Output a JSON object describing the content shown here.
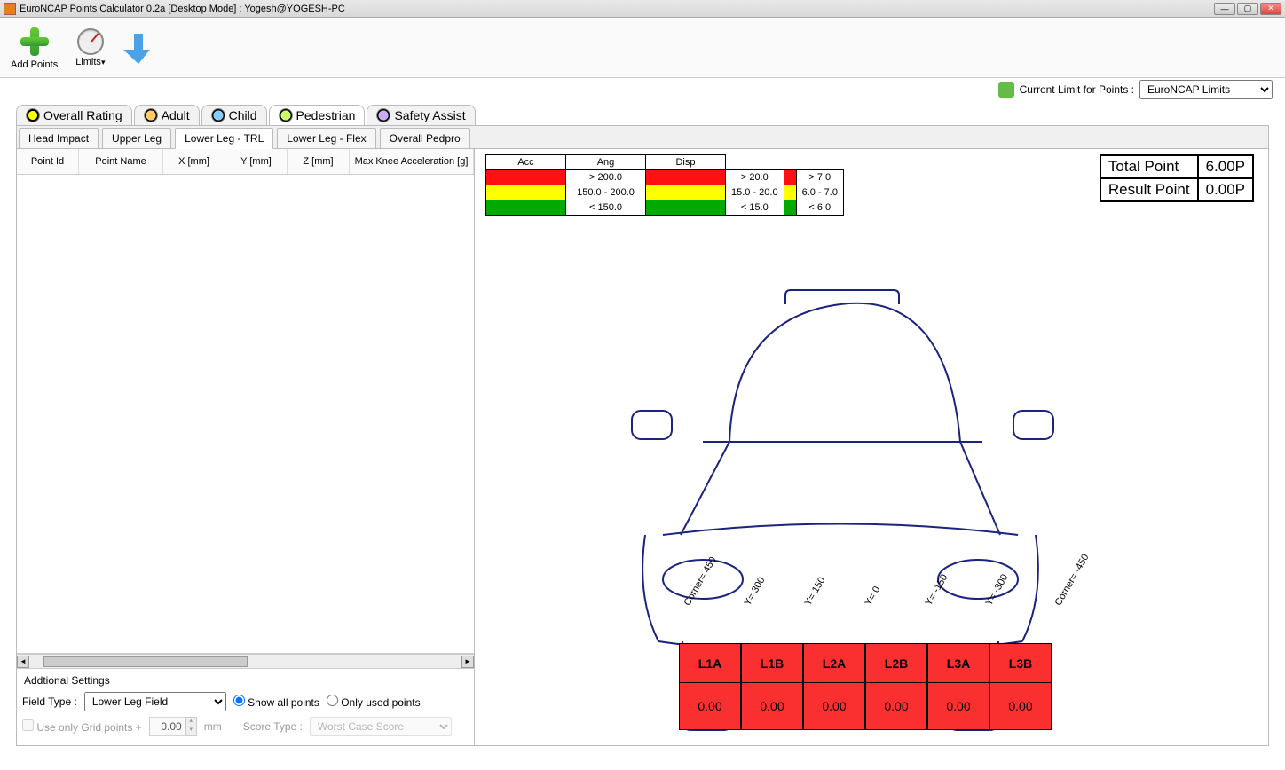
{
  "window": {
    "title": "EuroNCAP Points Calculator 0.2a [Desktop Mode] : Yogesh@YOGESH-PC"
  },
  "toolbar": {
    "add_points": "Add Points",
    "limits": "Limits"
  },
  "limits_bar": {
    "label": "Current Limit for Points :",
    "selected": "EuroNCAP Limits"
  },
  "tabs": [
    "Overall Rating",
    "Adult",
    "Child",
    "Pedestrian",
    "Safety Assist"
  ],
  "active_tab_index": 3,
  "subtabs": [
    "Head Impact",
    "Upper Leg",
    "Lower Leg - TRL",
    "Lower Leg - Flex",
    "Overall Pedpro"
  ],
  "active_subtab_index": 2,
  "grid_headers": [
    "Point Id",
    "Point Name",
    "X [mm]",
    "Y [mm]",
    "Z [mm]",
    "Max Knee Acceleration [g]"
  ],
  "legend": {
    "cols": [
      "Acc",
      "Ang",
      "Disp"
    ],
    "rows": [
      {
        "color": "red",
        "vals": [
          "> 200.0",
          "> 20.0",
          "> 7.0"
        ]
      },
      {
        "color": "yel",
        "vals": [
          "150.0 - 200.0",
          "15.0 - 20.0",
          "6.0 - 7.0"
        ]
      },
      {
        "color": "grn",
        "vals": [
          "< 150.0",
          "< 15.0",
          "< 6.0"
        ]
      }
    ]
  },
  "points": {
    "total_label": "Total Point",
    "total_val": "6.00P",
    "result_label": "Result Point",
    "result_val": "0.00P"
  },
  "bumper": {
    "zones": [
      "L1A",
      "L1B",
      "L2A",
      "L2B",
      "L3A",
      "L3B"
    ],
    "vals": [
      "0.00",
      "0.00",
      "0.00",
      "0.00",
      "0.00",
      "0.00"
    ]
  },
  "ylabels": [
    "Corner= 450",
    "Y= 300",
    "Y= 150",
    "Y= 0",
    "Y= -150",
    "Y= -300",
    "Corner= -450"
  ],
  "settings": {
    "title": "Addtional Settings",
    "field_type_label": "Field Type  :",
    "field_type_value": "Lower Leg Field",
    "show_all": "Show all points",
    "only_used": "Only used points",
    "grid_label": "Use only Grid points +",
    "grid_val": "0.00",
    "grid_unit": "mm",
    "score_label": "Score Type :",
    "score_value": "Worst Case Score"
  }
}
